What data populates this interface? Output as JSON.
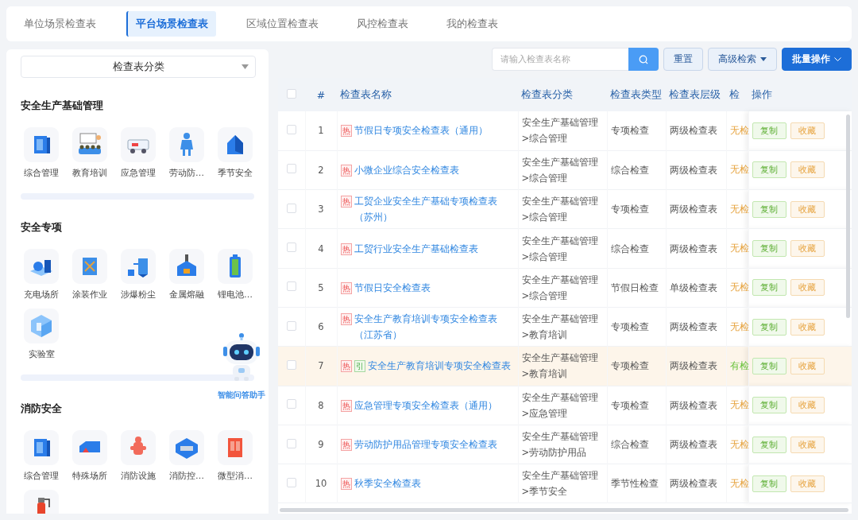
{
  "tabs": [
    {
      "label": "单位场景检查表",
      "selected": false
    },
    {
      "label": "平台场景检查表",
      "selected": true
    },
    {
      "label": "区域位置检查表",
      "selected": false
    },
    {
      "label": "风控检查表",
      "selected": false
    },
    {
      "label": "我的检查表",
      "selected": false
    }
  ],
  "sidebar": {
    "select": {
      "value": "检查表分类"
    },
    "sections": [
      {
        "title": "安全生产基础管理",
        "items": [
          {
            "kind": "labeled",
            "label": "综合管理"
          },
          {
            "kind": "labeled",
            "label": "教育培训"
          },
          {
            "kind": "labeled",
            "label": "应急管理"
          },
          {
            "kind": "labeled",
            "label": "劳动防…"
          },
          {
            "kind": "labeled",
            "label": "季节安全"
          }
        ]
      },
      {
        "title": "安全专项",
        "items": [
          {
            "kind": "labeled",
            "label": "充电场所"
          },
          {
            "kind": "labeled",
            "label": "涂装作业"
          },
          {
            "kind": "labeled",
            "label": "涉爆粉尘"
          },
          {
            "kind": "labeled",
            "label": "金属熔融"
          },
          {
            "kind": "labeled",
            "label": "锂电池…"
          },
          {
            "kind": "labeled",
            "label": "实验室"
          }
        ]
      },
      {
        "title": "消防安全",
        "items": [
          {
            "kind": "labeled",
            "label": "综合管理"
          },
          {
            "kind": "labeled",
            "label": "特殊场所"
          },
          {
            "kind": "labeled",
            "label": "消防设施"
          },
          {
            "kind": "labeled",
            "label": "消防控…"
          },
          {
            "kind": "labeled",
            "label": "微型消…"
          },
          {
            "kind": "icon"
          }
        ]
      }
    ],
    "assistant": {
      "label": "智能问答助手"
    }
  },
  "toolbar": {
    "search": {
      "placeholder": "请输入检查表名称"
    },
    "reset": "重置",
    "advanced": "高级检索",
    "batch": "批量操作"
  },
  "table": {
    "all_checked": false,
    "columns": [
      "#",
      "检查表名称",
      "检查表分类",
      "检查表类型",
      "检查表层级",
      "检",
      "操作"
    ],
    "rows": [
      {
        "checked": false,
        "selected": false,
        "index": "1",
        "tags": [
          {
            "kind": "hot",
            "label": "热"
          }
        ],
        "name": "节假日专项安全检查表（通用）",
        "category": "安全生产基础管理>综合管理",
        "type": "专项检查",
        "level": "两级检查表",
        "check": {
          "kind": "none",
          "text": "无检"
        },
        "actions": [
          "复制",
          "收藏"
        ]
      },
      {
        "checked": false,
        "selected": false,
        "index": "2",
        "tags": [
          {
            "kind": "hot",
            "label": "热"
          }
        ],
        "name": "小微企业综合安全检查表",
        "category": "安全生产基础管理>综合管理",
        "type": "综合检查",
        "level": "两级检查表",
        "check": {
          "kind": "none",
          "text": "无检"
        },
        "actions": [
          "复制",
          "收藏"
        ]
      },
      {
        "checked": false,
        "selected": false,
        "index": "3",
        "tags": [
          {
            "kind": "hot",
            "label": "热"
          }
        ],
        "name": "工贸企业安全生产基础专项检查表（苏州）",
        "category": "安全生产基础管理>综合管理",
        "type": "专项检查",
        "level": "两级检查表",
        "check": {
          "kind": "none",
          "text": "无检"
        },
        "actions": [
          "复制",
          "收藏"
        ]
      },
      {
        "checked": false,
        "selected": false,
        "index": "4",
        "tags": [
          {
            "kind": "hot",
            "label": "热"
          }
        ],
        "name": "工贸行业安全生产基础检查表",
        "category": "安全生产基础管理>综合管理",
        "type": "综合检查",
        "level": "两级检查表",
        "check": {
          "kind": "none",
          "text": "无检"
        },
        "actions": [
          "复制",
          "收藏"
        ]
      },
      {
        "checked": false,
        "selected": false,
        "index": "5",
        "tags": [
          {
            "kind": "hot",
            "label": "热"
          }
        ],
        "name": "节假日安全检查表",
        "category": "安全生产基础管理>综合管理",
        "type": "节假日检查",
        "level": "单级检查表",
        "check": {
          "kind": "none",
          "text": "无检"
        },
        "actions": [
          "复制",
          "收藏"
        ]
      },
      {
        "checked": false,
        "selected": false,
        "index": "6",
        "tags": [
          {
            "kind": "hot",
            "label": "热"
          }
        ],
        "name": "安全生产教育培训专项安全检查表（江苏省）",
        "category": "安全生产基础管理>教育培训",
        "type": "专项检查",
        "level": "两级检查表",
        "check": {
          "kind": "none",
          "text": "无检"
        },
        "actions": [
          "复制",
          "收藏"
        ]
      },
      {
        "checked": false,
        "selected": true,
        "index": "7",
        "tags": [
          {
            "kind": "hot",
            "label": "热"
          },
          {
            "kind": "cite",
            "label": "引"
          }
        ],
        "name": "安全生产教育培训专项安全检查表",
        "category": "安全生产基础管理>教育培训",
        "type": "专项检查",
        "level": "两级检查表",
        "check": {
          "kind": "has",
          "text": "有检"
        },
        "actions": [
          "复制",
          "收藏"
        ]
      },
      {
        "checked": false,
        "selected": false,
        "index": "8",
        "tags": [
          {
            "kind": "hot",
            "label": "热"
          }
        ],
        "name": "应急管理专项安全检查表（通用）",
        "category": "安全生产基础管理>应急管理",
        "type": "专项检查",
        "level": "两级检查表",
        "check": {
          "kind": "none",
          "text": "无检"
        },
        "actions": [
          "复制",
          "收藏"
        ]
      },
      {
        "checked": false,
        "selected": false,
        "index": "9",
        "tags": [
          {
            "kind": "hot",
            "label": "热"
          }
        ],
        "name": "劳动防护用品管理专项安全检查表",
        "category": "安全生产基础管理>劳动防护用品",
        "type": "综合检查",
        "level": "两级检查表",
        "check": {
          "kind": "none",
          "text": "无检"
        },
        "actions": [
          "复制",
          "收藏"
        ]
      },
      {
        "checked": false,
        "selected": false,
        "index": "10",
        "tags": [
          {
            "kind": "hot",
            "label": "热"
          }
        ],
        "name": "秋季安全检查表",
        "category": "安全生产基础管理>季节安全",
        "type": "季节性检查",
        "level": "两级检查表",
        "check": {
          "kind": "none",
          "text": "无检"
        },
        "actions": [
          "复制",
          "收藏"
        ]
      }
    ]
  }
}
